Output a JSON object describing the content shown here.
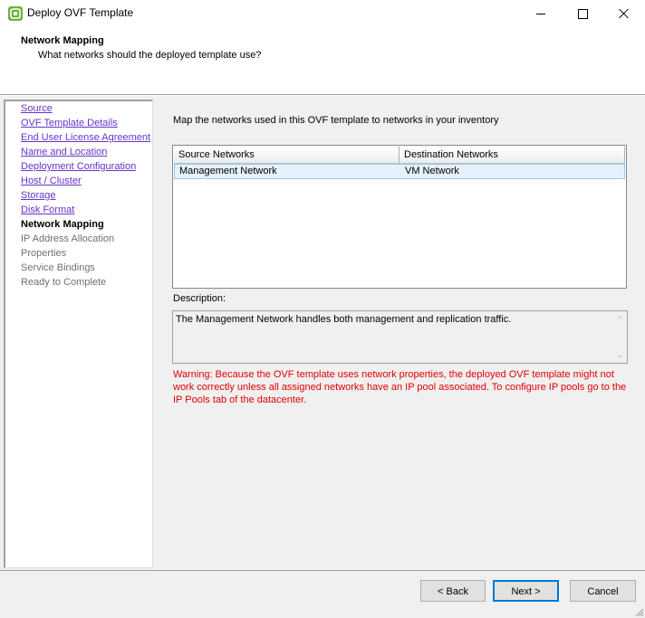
{
  "window": {
    "title": "Deploy OVF Template",
    "icon": "vsphere-logo-icon"
  },
  "header": {
    "title": "Network Mapping",
    "subtitle": "What networks should the deployed template use?"
  },
  "nav": {
    "items": [
      {
        "label": "Source",
        "state": "done"
      },
      {
        "label": "OVF Template Details",
        "state": "done"
      },
      {
        "label": "End User License Agreement",
        "state": "done"
      },
      {
        "label": "Name and Location",
        "state": "done"
      },
      {
        "label": "Deployment Configuration",
        "state": "done"
      },
      {
        "label": "Host / Cluster",
        "state": "done"
      },
      {
        "label": "Storage",
        "state": "done"
      },
      {
        "label": "Disk Format",
        "state": "done"
      },
      {
        "label": "Network Mapping",
        "state": "current"
      },
      {
        "label": "IP Address Allocation",
        "state": "future"
      },
      {
        "label": "Properties",
        "state": "future"
      },
      {
        "label": "Service Bindings",
        "state": "future"
      },
      {
        "label": "Ready to Complete",
        "state": "future"
      }
    ]
  },
  "main": {
    "instructions": "Map the networks used in this OVF template to networks in your inventory",
    "table": {
      "columns": [
        "Source Networks",
        "Destination Networks"
      ],
      "rows": [
        {
          "source": "Management Network",
          "destination": "VM Network"
        }
      ]
    },
    "description_label": "Description:",
    "description_text": "The Management Network handles both management and replication traffic.",
    "warning": "Warning: Because the OVF template uses network properties, the deployed OVF template might not work correctly unless all assigned networks have an IP pool associated. To configure IP pools go to the IP Pools tab of the datacenter."
  },
  "footer": {
    "back_label": "< Back",
    "next_label": "Next >",
    "cancel_label": "Cancel"
  },
  "colors": {
    "link": "#6633cc",
    "warning": "#e00000",
    "selection": "#e5f1fb",
    "focus": "#0078d7"
  }
}
